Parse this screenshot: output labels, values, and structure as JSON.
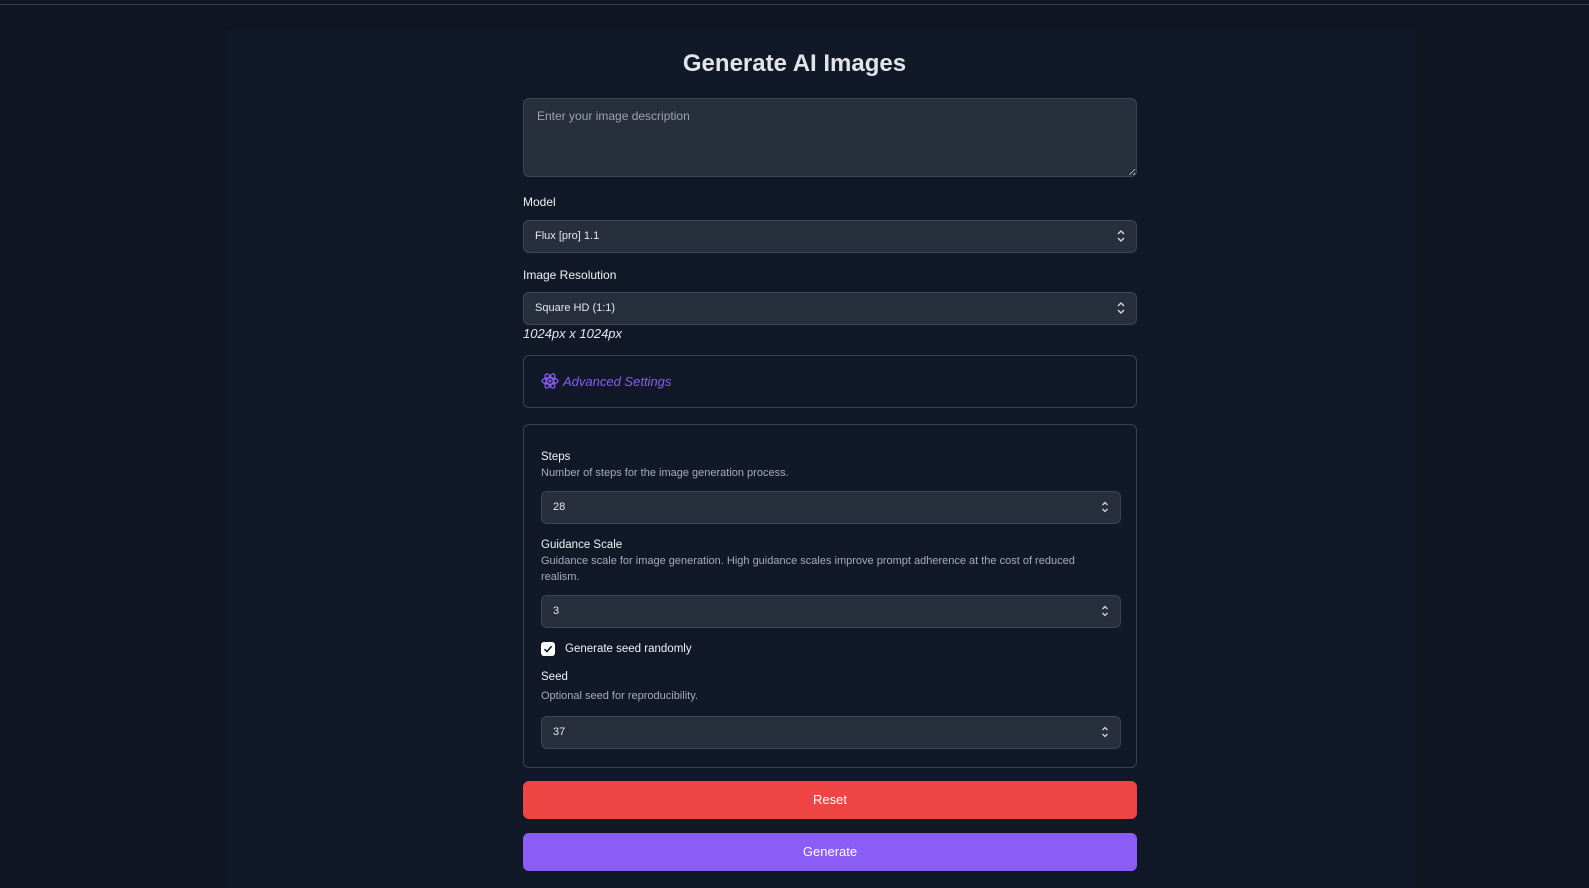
{
  "page": {
    "title": "Generate AI Images"
  },
  "prompt": {
    "placeholder": "Enter your image description",
    "value": ""
  },
  "model": {
    "label": "Model",
    "selected": "Flux [pro] 1.1"
  },
  "resolution": {
    "label": "Image Resolution",
    "selected": "Square HD (1:1)",
    "dimensions": "1024px x 1024px"
  },
  "advanced": {
    "label": "Advanced Settings",
    "icon": "atom-icon"
  },
  "settings": {
    "steps": {
      "label": "Steps",
      "description": "Number of steps for the image generation process.",
      "value": "28"
    },
    "guidance": {
      "label": "Guidance Scale",
      "description": "Guidance scale for image generation. High guidance scales improve prompt adherence at the cost of reduced realism.",
      "value": "3"
    },
    "random_seed": {
      "label": "Generate seed randomly",
      "checked": true
    },
    "seed": {
      "label": "Seed",
      "description": "Optional seed for reproducibility.",
      "value": "37"
    }
  },
  "buttons": {
    "reset": "Reset",
    "generate": "Generate"
  },
  "colors": {
    "background": "#111827",
    "accent": "#8b5cf6",
    "danger": "#ef4444",
    "input_bg": "#282f3c"
  }
}
